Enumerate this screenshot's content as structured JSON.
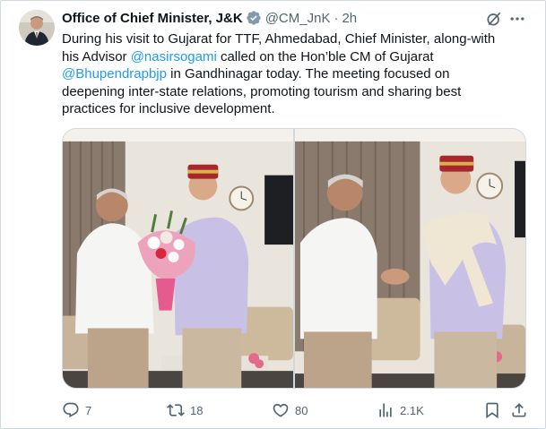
{
  "tweet": {
    "display_name": "Office of Chief Minister, J&K",
    "handle": "@CM_JnK",
    "separator": "·",
    "time": "2h",
    "text_lines": [
      [
        {
          "t": "During his visit to Gujarat for TTF, Ahmedabad, Chief Minister, along-with"
        }
      ],
      [
        {
          "t": "his Advisor "
        },
        {
          "t": "@nasirsogami",
          "mention": true
        },
        {
          "t": " called on the Hon’ble CM of Gujarat"
        }
      ],
      [
        {
          "t": "@Bhupendrapbjp",
          "mention": true
        },
        {
          "t": " in Gandhinagar today. The meeting focused on"
        }
      ],
      [
        {
          "t": "deepening inter-state relations, promoting tourism and sharing best"
        }
      ],
      [
        {
          "t": "practices for inclusive development."
        }
      ]
    ]
  },
  "actions": {
    "replies": "7",
    "reposts": "18",
    "likes": "80",
    "views": "2.1K"
  },
  "icons": {
    "verified": "verified-badge-icon",
    "grok": "grok-icon",
    "more": "more-options-icon",
    "reply": "reply-icon",
    "repost": "repost-icon",
    "like": "like-icon",
    "views": "views-icon",
    "bookmark": "bookmark-icon",
    "share": "share-icon"
  },
  "colors": {
    "text": "#0f1419",
    "secondary": "#536471",
    "link": "#1d9bf0",
    "border": "#cfd9de"
  }
}
